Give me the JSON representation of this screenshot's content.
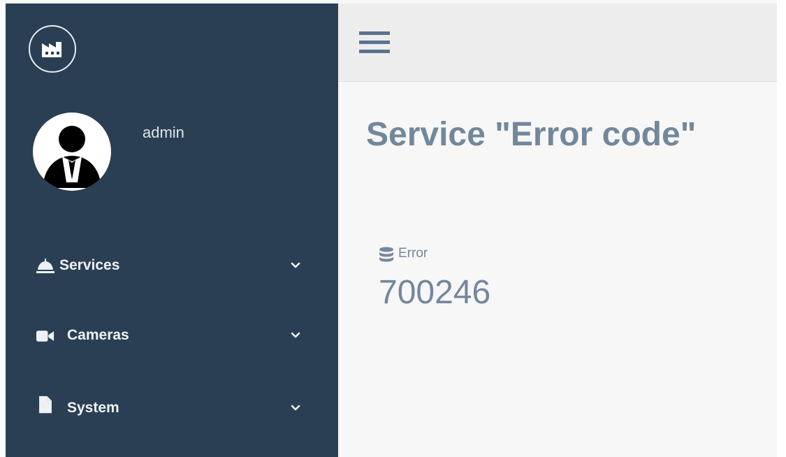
{
  "sidebar": {
    "logo_icon": "factory-icon",
    "profile": {
      "username": "admin",
      "avatar_icon": "user-businessman-icon"
    },
    "menu": [
      {
        "label": "Services",
        "icon": "bell-icon",
        "expand_icon": "chevron-down-icon"
      },
      {
        "label": "Cameras",
        "icon": "video-camera-icon",
        "expand_icon": "chevron-down-icon"
      },
      {
        "label": "System",
        "icon": "file-icon",
        "expand_icon": "chevron-down-icon"
      }
    ]
  },
  "topbar": {
    "menu_toggle_icon": "hamburger-icon"
  },
  "page": {
    "title": "Service \"Error code\"",
    "metric": {
      "icon": "database-icon",
      "label": "Error",
      "value": "700246"
    }
  },
  "colors": {
    "sidebar_bg": "#2a3f54",
    "content_bg": "#f7f7f7",
    "topbar_bg": "#ededed",
    "text_muted": "#73879c"
  }
}
